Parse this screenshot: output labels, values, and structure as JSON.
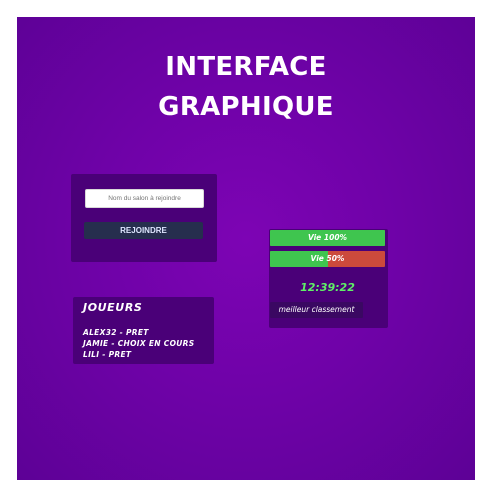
{
  "title": {
    "line1": "INTERFACE",
    "line2": "GRAPHIQUE"
  },
  "join": {
    "placeholder": "Nom du salon à rejoindre",
    "button_label": "REJOINDRE"
  },
  "players": {
    "title": "JOUEURS",
    "lines": [
      "ALEX32 - PRET",
      "JAMIE - CHOIX EN COURS",
      "LILI - PRET"
    ]
  },
  "status": {
    "health_bars": [
      {
        "label": "Vie 100%",
        "value": 100
      },
      {
        "label": "Vie 50%",
        "value": 50
      }
    ],
    "timer": "12:39:22",
    "ranking_label": "meilleur classement"
  },
  "colors": {
    "background": "#6f02a8",
    "panel": "#4a0078",
    "health_full": "#3fc54f",
    "health_lost": "#cc4a3c",
    "timer": "#5ff067",
    "button": "#262e4e"
  }
}
